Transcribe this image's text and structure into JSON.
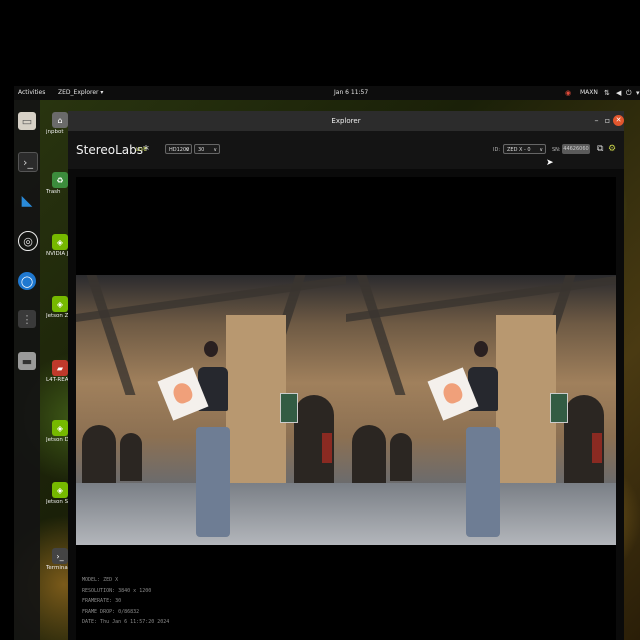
{
  "topbar": {
    "activities": "Activities",
    "app_menu": "ZED_Explorer ▾",
    "clock": "Jan 6 11:57",
    "power_mode": "MAXN"
  },
  "dock": {
    "items": [
      "files-icon",
      "terminal-icon",
      "vscode-icon",
      "obs-icon",
      "chromium-icon",
      "app-grid-icon",
      "disk-icon"
    ]
  },
  "desktop": {
    "icons": [
      {
        "label": "jnpbot"
      },
      {
        "label": "Trash"
      },
      {
        "label": "NVIDIA Jetson Community P"
      },
      {
        "label": "Jetson Zoo"
      },
      {
        "label": "L4T-README"
      },
      {
        "label": "Jetson Developer Z"
      },
      {
        "label": "Jetson Support Forums"
      },
      {
        "label": "Terminal"
      }
    ]
  },
  "window": {
    "title": "Explorer",
    "brand": "StereoLabs*",
    "status": "LIVE",
    "resolution_select": "HD1200",
    "fps_select": "30",
    "id_label": "ID:",
    "device_select": "ZED X - 0",
    "sn_label": "SN:",
    "sn_value": "44626060"
  },
  "info": {
    "model": "MODEL: ZED X",
    "resolution": "RESOLUTION: 3840 x 1200",
    "framerate": "FRAMERATE: 30",
    "frame_drop": "FRAME DROP: 0/86832",
    "date": "DATE: Thu Jan 6 11:57:20 2024"
  }
}
